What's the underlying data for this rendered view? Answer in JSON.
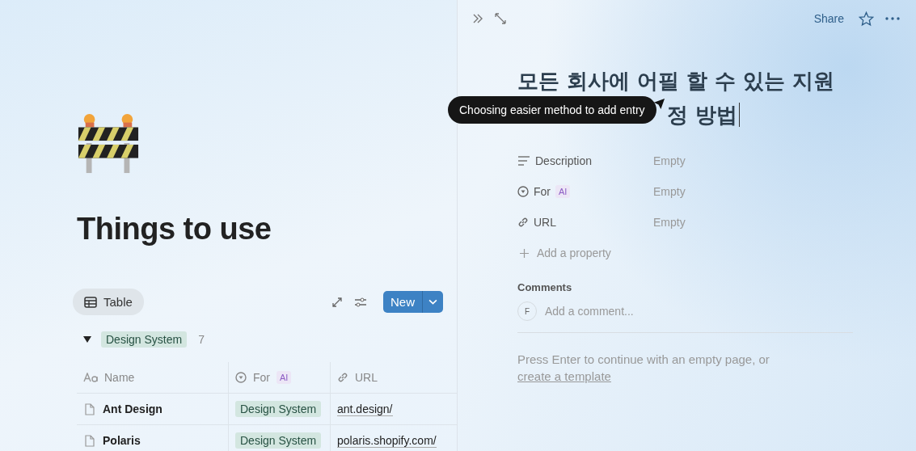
{
  "left": {
    "title": "Things to use",
    "view_tab": {
      "label": "Table",
      "selected": true
    },
    "new_button": {
      "label": "New"
    },
    "group": {
      "label": "Design System",
      "count": "7",
      "expanded": true
    },
    "columns": [
      {
        "kind": "name",
        "label": "Name"
      },
      {
        "kind": "select",
        "label": "For",
        "badge": "AI"
      },
      {
        "kind": "url",
        "label": "URL"
      }
    ],
    "rows": [
      {
        "name": "Ant Design",
        "for": "Design System",
        "url": "ant.design/"
      },
      {
        "name": "Polaris",
        "for": "Design System",
        "url": "polaris.shopify.com/"
      }
    ]
  },
  "right": {
    "toolbar": {
      "share": "Share"
    },
    "title_line_1": "모든 회사에 어필 할 수 있는 지원",
    "title_line_2": "정 방법",
    "tooltip": "Choosing easier method to add entry",
    "properties": [
      {
        "kind": "text",
        "label": "Description",
        "value": "Empty"
      },
      {
        "kind": "select",
        "label": "For",
        "badge": "AI",
        "value": "Empty"
      },
      {
        "kind": "url",
        "label": "URL",
        "value": "Empty"
      }
    ],
    "add_property": "Add a property",
    "comments": {
      "heading": "Comments",
      "avatar": "F",
      "placeholder": "Add a comment..."
    },
    "hint": "Press Enter to continue with an empty page, or",
    "hint_link": "create a template"
  }
}
